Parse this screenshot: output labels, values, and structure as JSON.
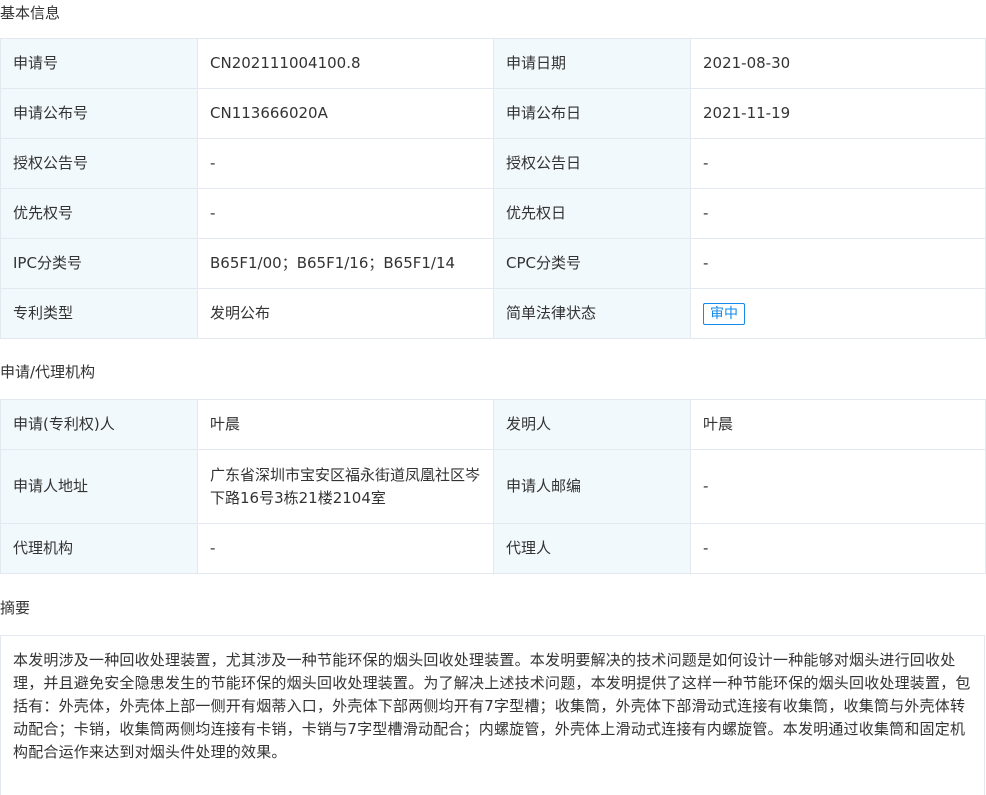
{
  "sections": {
    "basic": "基本信息",
    "applicant": "申请/代理机构",
    "abstract": "摘要"
  },
  "basic_info": [
    {
      "label1": "申请号",
      "value1": "CN202111004100.8",
      "label2": "申请日期",
      "value2": "2021-08-30"
    },
    {
      "label1": "申请公布号",
      "value1": "CN113666020A",
      "label2": "申请公布日",
      "value2": "2021-11-19"
    },
    {
      "label1": "授权公告号",
      "value1": "-",
      "label2": "授权公告日",
      "value2": "-"
    },
    {
      "label1": "优先权号",
      "value1": "-",
      "label2": "优先权日",
      "value2": "-"
    },
    {
      "label1": "IPC分类号",
      "value1": "B65F1/00；B65F1/16；B65F1/14",
      "label2": "CPC分类号",
      "value2": "-"
    },
    {
      "label1": "专利类型",
      "value1": "发明公布",
      "label2": "简单法律状态",
      "value2": "审中"
    }
  ],
  "applicant_info": [
    {
      "label1": "申请(专利权)人",
      "value1": "叶晨",
      "label2": "发明人",
      "value2": "叶晨"
    },
    {
      "label1": "申请人地址",
      "value1": "广东省深圳市宝安区福永街道凤凰社区岑下路16号3栋21楼2104室",
      "label2": "申请人邮编",
      "value2": "-"
    },
    {
      "label1": "代理机构",
      "value1": "-",
      "label2": "代理人",
      "value2": "-"
    }
  ],
  "abstract_text": "本发明涉及一种回收处理装置，尤其涉及一种节能环保的烟头回收处理装置。本发明要解决的技术问题是如何设计一种能够对烟头进行回收处理，并且避免安全隐患发生的节能环保的烟头回收处理装置。为了解决上述技术问题，本发明提供了这样一种节能环保的烟头回收处理装置，包括有：外壳体，外壳体上部一侧开有烟蒂入口，外壳体下部两侧均开有7字型槽；收集筒，外壳体下部滑动式连接有收集筒，收集筒与外壳体转动配合；卡销，收集筒两侧均连接有卡销，卡销与7字型槽滑动配合；内螺旋管，外壳体上滑动式连接有内螺旋管。本发明通过收集筒和固定机构配合运作来达到对烟头件处理的效果。",
  "colors": {
    "label_bg": "#f2f9fc",
    "border": "#e4e8f0",
    "badge": "#128bed"
  }
}
